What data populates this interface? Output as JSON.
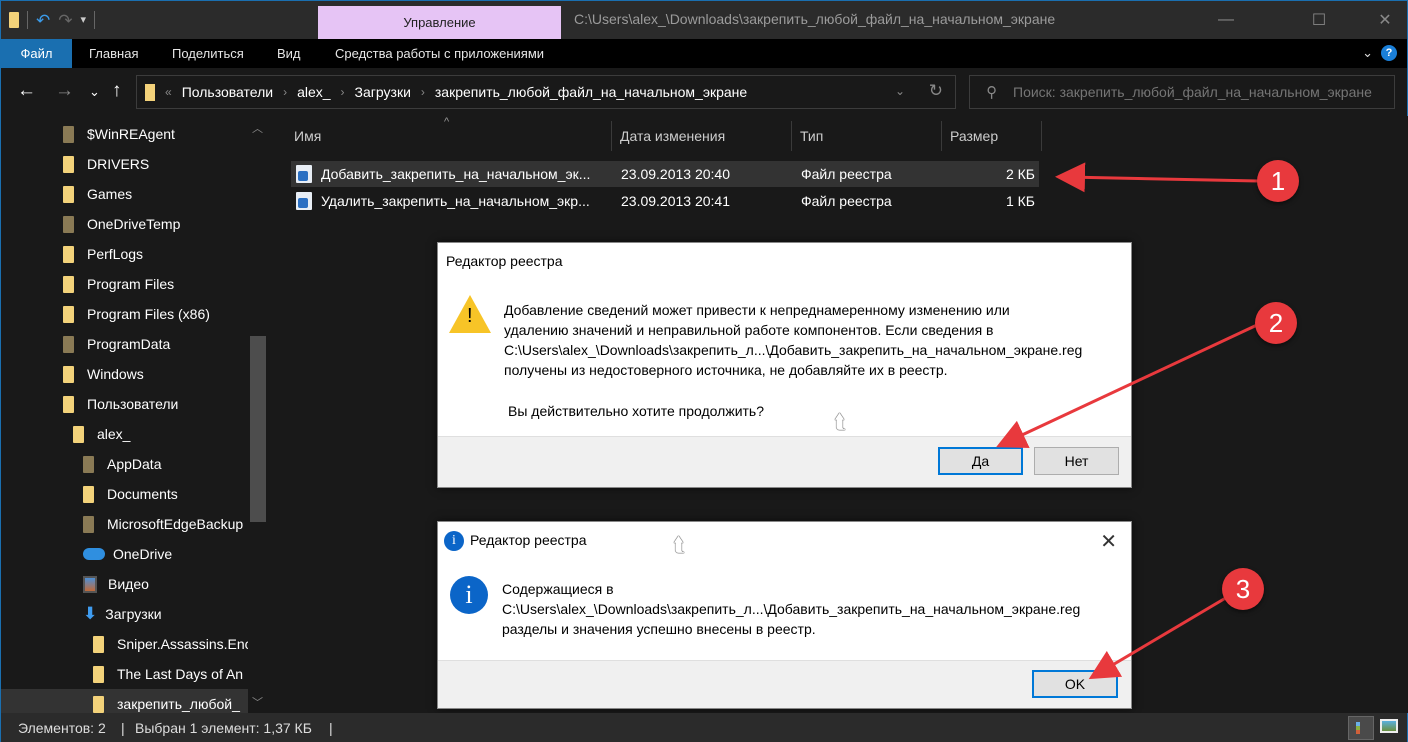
{
  "window": {
    "title_path": "C:\\Users\\alex_\\Downloads\\закрепить_любой_файл_на_начальном_экране",
    "contextual_tab": "Управление",
    "controls": {
      "minimize": "—",
      "maximize": "☐",
      "close": "✕"
    }
  },
  "quick_access": {
    "undo": "↶",
    "redo": "↷",
    "customize": "▾"
  },
  "ribbon": {
    "tabs": [
      {
        "label": "Файл",
        "active": true
      },
      {
        "label": "Главная"
      },
      {
        "label": "Поделиться"
      },
      {
        "label": "Вид"
      },
      {
        "label": "Средства работы с приложениями"
      }
    ],
    "collapse_icon": "⌄",
    "help_icon": "?"
  },
  "nav": {
    "back": "←",
    "forward": "→",
    "recent": "⌄",
    "up": "↑",
    "breadcrumb_overflow": "«",
    "breadcrumbs": [
      "Пользователи",
      "alex_",
      "Загрузки",
      "закрепить_любой_файл_на_начальном_экране"
    ],
    "crumb_separator": "›",
    "dropdown_icon": "⌄",
    "refresh_icon": "↻",
    "search_icon": "⚲",
    "search_placeholder": "Поиск: закрепить_любой_файл_на_начальном_экране"
  },
  "sidebar": {
    "items": [
      {
        "label": "$WinREAgent",
        "type": "folder-hidden",
        "level": 0
      },
      {
        "label": "DRIVERS",
        "type": "folder",
        "level": 0
      },
      {
        "label": "Games",
        "type": "folder",
        "level": 0
      },
      {
        "label": "OneDriveTemp",
        "type": "folder-hidden",
        "level": 0
      },
      {
        "label": "PerfLogs",
        "type": "folder",
        "level": 0
      },
      {
        "label": "Program Files",
        "type": "folder",
        "level": 0
      },
      {
        "label": "Program Files (x86)",
        "type": "folder",
        "level": 0
      },
      {
        "label": "ProgramData",
        "type": "folder-hidden",
        "level": 0
      },
      {
        "label": "Windows",
        "type": "folder",
        "level": 0
      },
      {
        "label": "Пользователи",
        "type": "folder",
        "level": 0
      },
      {
        "label": "alex_",
        "type": "folder",
        "level": 1
      },
      {
        "label": "AppData",
        "type": "folder-hidden",
        "level": 2
      },
      {
        "label": "Documents",
        "type": "folder",
        "level": 2
      },
      {
        "label": "MicrosoftEdgeBackup",
        "type": "folder-hidden",
        "level": 2
      },
      {
        "label": "OneDrive",
        "type": "onedrive",
        "level": 2
      },
      {
        "label": "Видео",
        "type": "video",
        "level": 2
      },
      {
        "label": "Загрузки",
        "type": "downloads",
        "level": 2
      },
      {
        "label": "Sniper.Assassins.Enc",
        "type": "folder",
        "level": 3
      },
      {
        "label": "The Last Days of An",
        "type": "folder",
        "level": 3
      },
      {
        "label": "закрепить_любой_",
        "type": "folder",
        "level": 3,
        "selected": true
      }
    ]
  },
  "file_list": {
    "columns": [
      "Имя",
      "Дата изменения",
      "Тип",
      "Размер"
    ],
    "sort_indicator": "^",
    "rows": [
      {
        "name": "Добавить_закрепить_на_начальном_эк...",
        "date": "23.09.2013 20:40",
        "type": "Файл реестра",
        "size": "2 КБ",
        "selected": true
      },
      {
        "name": "Удалить_закрепить_на_начальном_экр...",
        "date": "23.09.2013 20:41",
        "type": "Файл реестра",
        "size": "1 КБ",
        "selected": false
      }
    ]
  },
  "dialog_confirm": {
    "title": "Редактор реестра",
    "warning_glyph": "!",
    "lines": [
      "Добавление сведений может привести к непреднамеренному изменению или",
      "удалению значений и неправильной работе компонентов. Если сведения в",
      "C:\\Users\\alex_\\Downloads\\закрепить_л...\\Добавить_закрепить_на_начальном_экране.reg",
      "получены из недостоверного источника, не добавляйте их в реестр."
    ],
    "question": "Вы действительно хотите продолжить?",
    "yes_label": "Да",
    "no_label": "Нет"
  },
  "dialog_info": {
    "title": "Редактор реестра",
    "info_glyph": "i",
    "close_icon": "✕",
    "lines": [
      "Содержащиеся в",
      "C:\\Users\\alex_\\Downloads\\закрепить_л...\\Добавить_закрепить_на_начальном_экране.reg",
      "разделы и значения успешно внесены в реестр."
    ],
    "ok_label": "OK"
  },
  "status_bar": {
    "items_count": "Элементов: 2",
    "separator": "|",
    "selection": "Выбран 1 элемент: 1,37 КБ"
  },
  "annotations": {
    "color": "#e8393d",
    "steps": [
      "1",
      "2",
      "3"
    ]
  },
  "cursor_glyph": "➚"
}
